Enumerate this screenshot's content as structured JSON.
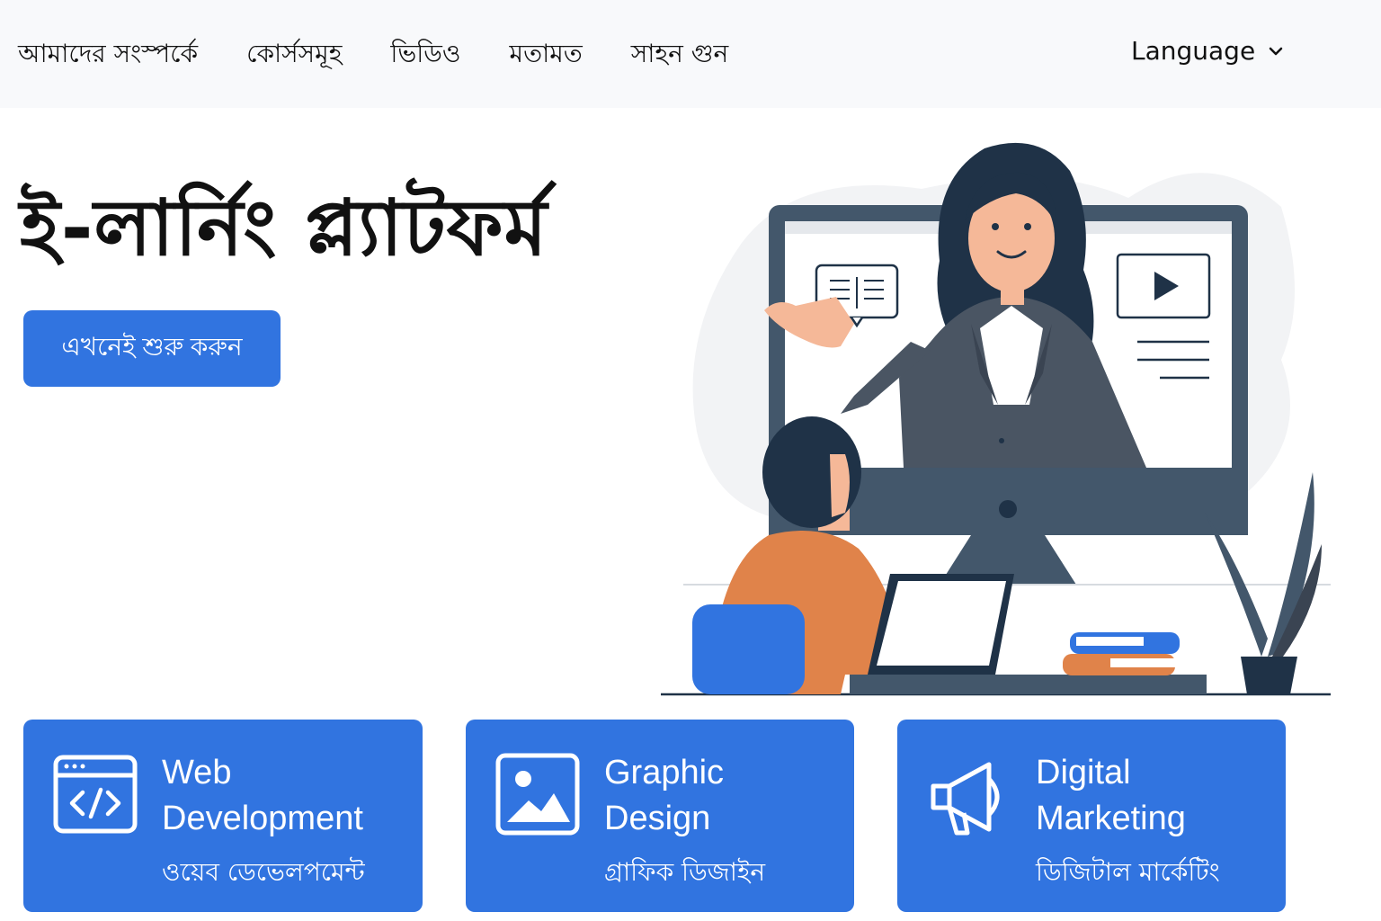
{
  "nav": {
    "links": [
      {
        "label": "আমাদের সংস্পর্কে"
      },
      {
        "label": "কোর্সসমূহ"
      },
      {
        "label": "ভিডিও"
      },
      {
        "label": "মতামত"
      },
      {
        "label": "সাহন গুন"
      }
    ],
    "language_label": "Language",
    "language_icon": "chevron-down-icon"
  },
  "hero": {
    "title": "ই-লার্নিং প্ল্যাটফর্ম",
    "cta_label": "এখনেই শুরু করুন"
  },
  "cards": [
    {
      "title": "Web Development",
      "subtitle": "ওয়েব ডেভেলপমেন্ট",
      "icon": "code-window-icon"
    },
    {
      "title": "Graphic Design",
      "subtitle": "গ্রাফিক ডিজাইন",
      "icon": "image-icon"
    },
    {
      "title": "Digital Marketing",
      "subtitle": "ডিজিটাল মার্কেটিং",
      "icon": "megaphone-icon"
    }
  ],
  "colors": {
    "accent": "#3174e0",
    "nav_bg": "#f8f9fb",
    "illustration_dark": "#1f3247",
    "illustration_orange": "#e0834a"
  }
}
